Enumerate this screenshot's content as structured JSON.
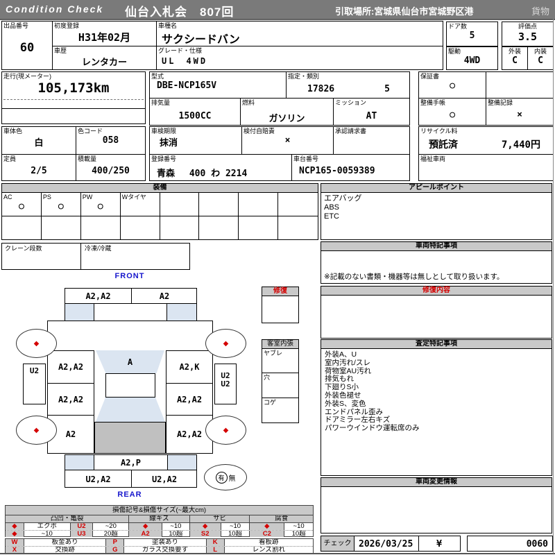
{
  "header": {
    "brand": "Condition  Check",
    "title": "仙台入札会　807回",
    "pickup": "引取場所:宮城県仙台市宮城野区港",
    "category": "貨物"
  },
  "vehicle": {
    "lot_label": "出品番号",
    "lot": "60",
    "first_reg_label": "初度登録",
    "first_reg": "H31年02月",
    "model_label": "車種名",
    "model": "サクシードバン",
    "history_label": "車歴",
    "history": "レンタカー",
    "grade_label": "グレード・仕様",
    "grade": "UL　4WD",
    "doors_label": "ドア数",
    "doors": "5",
    "score_label": "評価点",
    "score": "3.5",
    "drive_label": "駆動",
    "drive": "4WD",
    "ext_label": "外装",
    "ext_value": "C",
    "int_label": "内装",
    "int_value": "C",
    "mileage_label": "走行(現メーター)",
    "mileage": "105,173km",
    "type_label": "型式",
    "type_value": "DBE-NCP165V",
    "class_label": "指定・類別",
    "class1": "17826",
    "class2": "5",
    "disp_label": "排気量",
    "disp": "1500CC",
    "fuel_label": "燃料",
    "fuel": "ガソリン",
    "mission_label": "ミッション",
    "mission": "AT",
    "warranty_label": "保証書",
    "warranty": "○",
    "book_label": "整備手帳",
    "book": "○",
    "record_label": "整備記録",
    "record": "×",
    "color_label": "車体色",
    "color": "白",
    "color_code_label": "色コード",
    "color_code": "058",
    "inspection_label": "車検期限",
    "inspection": "抹消",
    "insurance_label": "検付自賠責",
    "insurance": "×",
    "approval_label": "承認請求書",
    "capacity_label": "定員",
    "capacity": "2/5",
    "load_label": "積載量",
    "load": "400/250",
    "plate_label": "登録番号",
    "plate": "青森　 400 わ 2214",
    "vin_label": "車台番号",
    "vin": "NCP165-0059389",
    "recycle_label": "リサイクル料",
    "recycle_status": "預託済",
    "recycle_fee": "7,440円",
    "welfare_label": "福祉車両"
  },
  "equipment": {
    "title": "装備",
    "cols": [
      {
        "label": "AC",
        "value": "○"
      },
      {
        "label": "PS",
        "value": "○"
      },
      {
        "label": "PW",
        "value": "○"
      },
      {
        "label": "Wタイヤ",
        "value": ""
      }
    ],
    "crane_label": "クレーン段数",
    "fridge_label": "冷凍/冷蔵"
  },
  "appeal": {
    "title": "アピールポイント",
    "items": [
      "エアバッグ",
      "ABS",
      "ETC"
    ]
  },
  "special": {
    "title": "車両特記事項",
    "note": "※記載のない書類・機器等は無しとして取り扱います。"
  },
  "repair": {
    "title": "修復内容"
  },
  "assessment": {
    "title": "査定特記事項",
    "items": [
      "外装A、U",
      "室内汚れ/スレ",
      "荷物室AU汚れ",
      "排気もれ",
      "下廻りS小",
      "外装色褪せ",
      "外装S、変色",
      "エンドパネル歪み",
      "ドアミラー左右キズ",
      "パワーウインドウ運転席のみ"
    ]
  },
  "change": {
    "title": "車両変更情報"
  },
  "check": {
    "label": "チェック",
    "date": "2026/03/25",
    "mark": "¥",
    "number": "0060"
  },
  "diagram": {
    "front": "FRONT",
    "rear": "REAR",
    "wheel_mark": "◆",
    "marks": {
      "front_bumper_left": "A2,A2",
      "front_bumper_right": "A2",
      "door_front_left": "A2,A2",
      "windshield": "A",
      "door_front_right": "A2,K",
      "sill_left": "U2",
      "sill_right_1": "U2",
      "sill_right_2": "U2",
      "door_rear_left": "A2,A2",
      "door_rear_right": "A2,A2",
      "quarter_left": "A2",
      "quarter_right": "A2,A2",
      "rear_panel": "A2,P",
      "rear_bumper_left": "U2,A2",
      "rear_bumper_right": "U2,A2"
    },
    "repair_title": "修復",
    "interior": {
      "title": "客室内張",
      "rows": [
        "ヤブレ",
        "穴",
        "コゲ"
      ]
    },
    "availability": {
      "yes": "有",
      "no": "無"
    }
  },
  "legend": {
    "title": "損傷記号&損傷サイズ(~最大cm)",
    "group_dent": "凸凹・亀裂",
    "group_scratch": "線キズ",
    "group_rust": "サビ",
    "group_corrosion": "腐食",
    "dent": [
      [
        "◆",
        "エクボ",
        "U2",
        "~20"
      ],
      [
        "◆",
        "~10",
        "U3",
        "20超"
      ]
    ],
    "scratch": [
      [
        "◆",
        "~10"
      ],
      [
        "A2",
        "10超"
      ]
    ],
    "rust": [
      [
        "◆",
        "~10"
      ],
      [
        "S2",
        "10超"
      ]
    ],
    "corrosion": [
      [
        "◆",
        "~10"
      ],
      [
        "C2",
        "10超"
      ]
    ],
    "codes": [
      [
        "W",
        "板金あり"
      ],
      [
        "X",
        "交換跡"
      ],
      [
        "P",
        "塗装あり"
      ],
      [
        "G",
        "ガラス交換要す"
      ],
      [
        "K",
        "看板跡"
      ],
      [
        "L",
        "レンズ割れ"
      ]
    ]
  },
  "colors": {
    "bar_gray": "#7a7a7a",
    "header_gray": "#c9c9c9",
    "glass_blue": "#dbe5f1",
    "cargo_gray": "#c0c0c0",
    "accent_red": "#d40000",
    "label_blue": "#1515cc"
  }
}
